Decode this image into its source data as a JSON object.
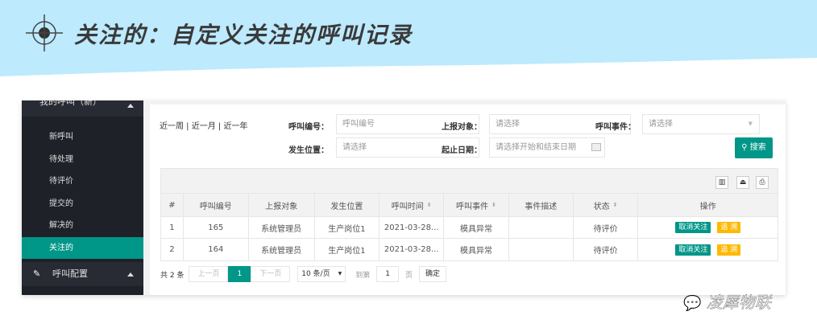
{
  "header": {
    "title": "关注的：自定义关注的呼叫记录",
    "icon": "crosshair-icon"
  },
  "sidebar": {
    "group1": "我的呼叫（新）",
    "items": [
      {
        "label": "新呼叫"
      },
      {
        "label": "待处理"
      },
      {
        "label": "待评价"
      },
      {
        "label": "提交的"
      },
      {
        "label": "解决的"
      },
      {
        "label": "关注的",
        "active": true
      }
    ],
    "group2": "呼叫配置"
  },
  "filters": {
    "quick": "近一周 | 近一月 | 近一年",
    "call_no_label": "呼叫编号：",
    "call_no_placeholder": "呼叫编号",
    "reporter_label": "上报对象：",
    "reporter_placeholder": "请选择",
    "event_label": "呼叫事件：",
    "event_placeholder": "请选择",
    "location_label": "发生位置：",
    "location_placeholder": "请选择",
    "date_label": "起止日期：",
    "date_placeholder": "请选择开始和结束日期",
    "search": "搜索"
  },
  "table": {
    "columns": [
      "#",
      "呼叫编号",
      "上报对象",
      "发生位置",
      "呼叫时间",
      "呼叫事件",
      "事件描述",
      "状态",
      "操作"
    ],
    "rows": [
      [
        "1",
        "165",
        "系统管理员",
        "生产岗位1",
        "2021-03-28...",
        "模具异常",
        "",
        "待评价"
      ],
      [
        "2",
        "164",
        "系统管理员",
        "生产岗位1",
        "2021-03-28...",
        "模具异常",
        "",
        "待评价"
      ]
    ],
    "actions": {
      "unfollow": "取消关注",
      "trace": "追 溯"
    }
  },
  "pagination": {
    "total": "共 2 条",
    "prev": "上一页",
    "current": "1",
    "next": "下一页",
    "page_size": "10 条/页",
    "goto": "到第",
    "goto_value": "1",
    "page": "页",
    "confirm": "确定"
  },
  "watermark": "凌犀物联",
  "colors": {
    "accent": "#009688",
    "warn": "#ffb800",
    "sidebar": "#1f2129",
    "banner": "#bdeafc"
  }
}
